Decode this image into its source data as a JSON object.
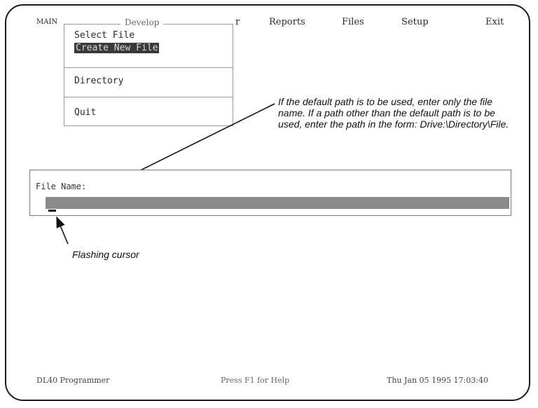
{
  "menubar": {
    "items": [
      "MAIN",
      "Develop",
      "r",
      "Reports",
      "Files",
      "Setup",
      "Exit"
    ]
  },
  "develop_menu": {
    "title": "Develop",
    "items": [
      "Select File",
      "Create New File",
      "Directory",
      "Quit"
    ],
    "selected": "Create New File"
  },
  "annotation_path": "If the default path is to be used, enter only the file name. If a path other than the default path is to be used, enter the path in the form: Drive:\\Directory\\File.",
  "file_name_label": "File Name:",
  "cursor_annotation": "Flashing cursor",
  "status": {
    "left": "DL40 Programmer",
    "center": "Press F1 for Help",
    "right": "Thu Jan 05 1995 17:03:40"
  }
}
